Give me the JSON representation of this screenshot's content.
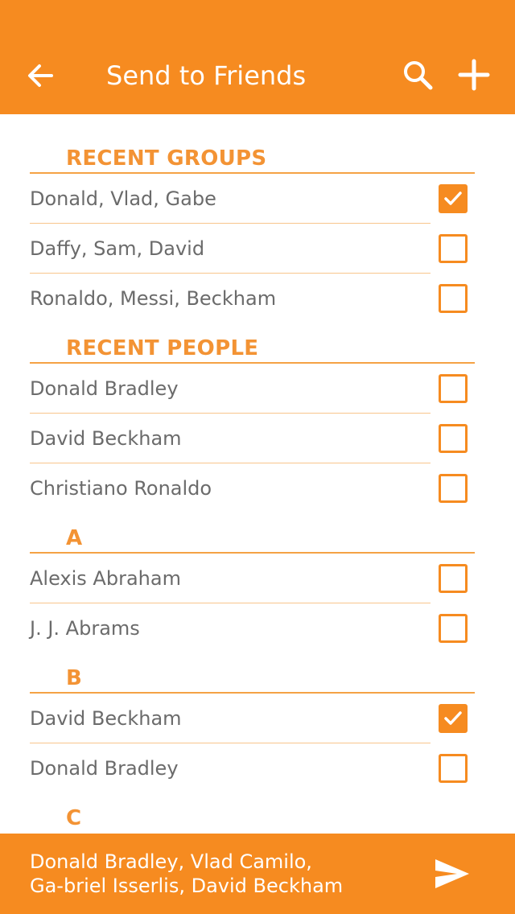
{
  "header": {
    "title": "Send to Friends",
    "back_icon": "arrow-left-icon",
    "search_icon": "search-icon",
    "add_icon": "plus-icon"
  },
  "colors": {
    "accent": "#F68B20",
    "section_text": "#F39334",
    "item_text": "#6b6b6b"
  },
  "sections": [
    {
      "title": "RECENT GROUPS",
      "items": [
        {
          "label": "Donald, Vlad, Gabe",
          "checked": true
        },
        {
          "label": "Daffy, Sam, David",
          "checked": false
        },
        {
          "label": "Ronaldo, Messi, Beckham",
          "checked": false
        }
      ]
    },
    {
      "title": "RECENT PEOPLE",
      "items": [
        {
          "label": "Donald Bradley",
          "checked": false
        },
        {
          "label": "David Beckham",
          "checked": false
        },
        {
          "label": "Christiano Ronaldo",
          "checked": false
        }
      ]
    },
    {
      "title": "A",
      "items": [
        {
          "label": "Alexis Abraham",
          "checked": false
        },
        {
          "label": "J. J. Abrams",
          "checked": false
        }
      ]
    },
    {
      "title": "B",
      "items": [
        {
          "label": "David Beckham",
          "checked": true
        },
        {
          "label": "Donald Bradley",
          "checked": false
        }
      ]
    },
    {
      "title": "C",
      "items": []
    }
  ],
  "footer": {
    "selected_recipients": "Donald Bradley, Vlad Camilo, Ga-briel Isserlis, David Beckham",
    "send_icon": "send-icon"
  }
}
